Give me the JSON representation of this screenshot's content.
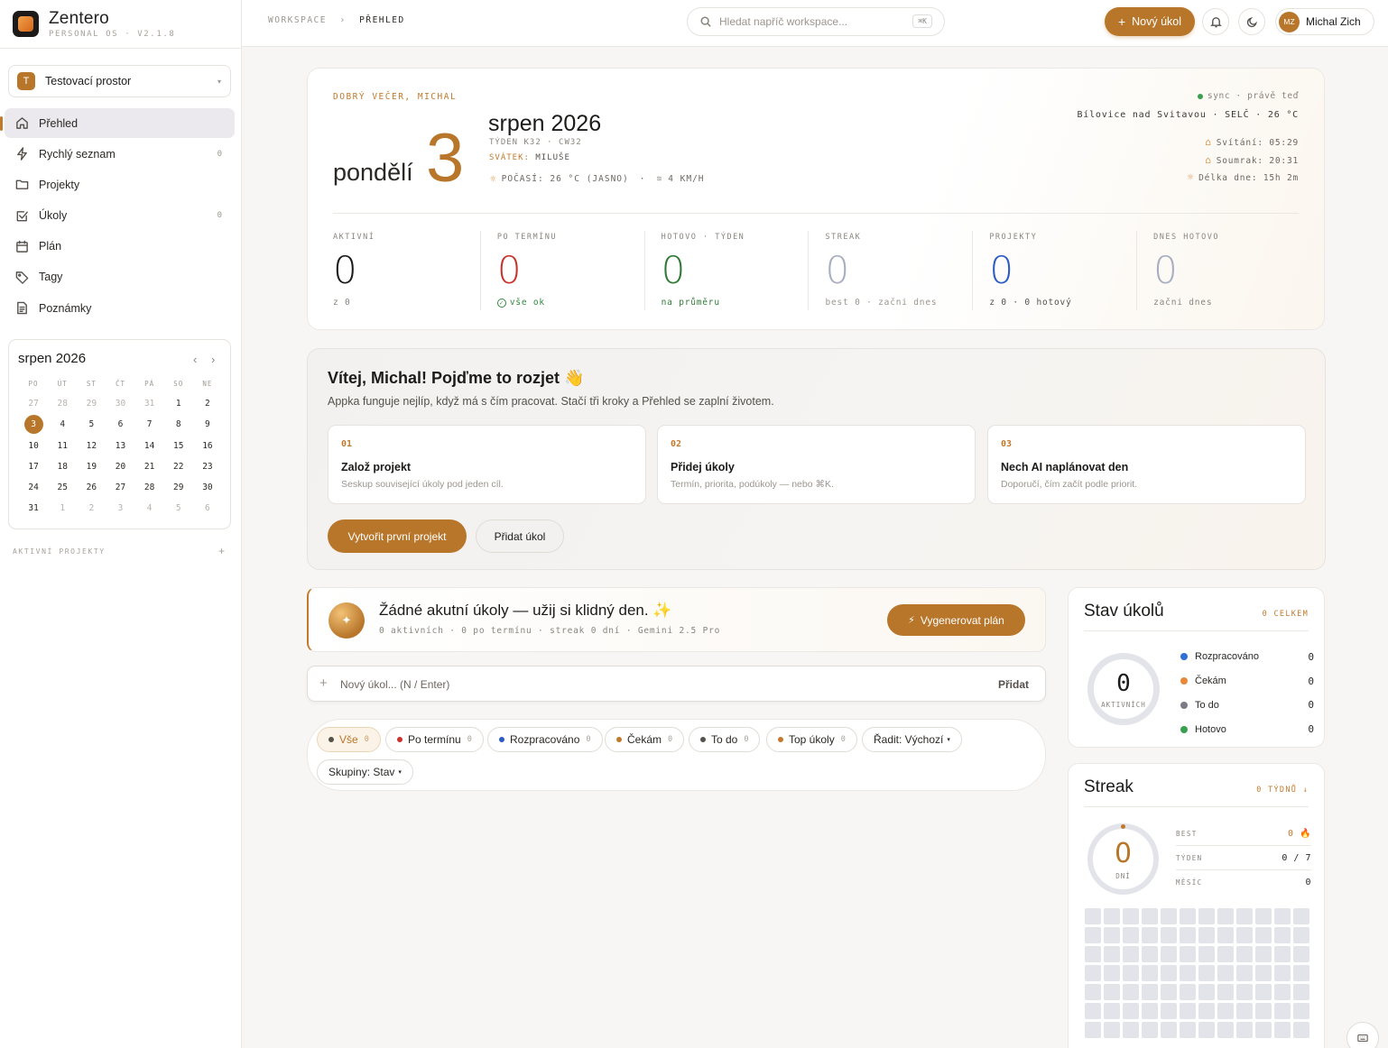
{
  "app": {
    "name": "Zentero",
    "version": "PERSONAL OS · V2.1.8"
  },
  "workspace": {
    "badge": "T",
    "name": "Testovací prostor"
  },
  "nav": [
    {
      "label": "Přehled",
      "count": "",
      "icon": "home-icon"
    },
    {
      "label": "Rychlý seznam",
      "count": "0",
      "icon": "bolt-icon"
    },
    {
      "label": "Projekty",
      "count": "",
      "icon": "folder-icon"
    },
    {
      "label": "Úkoly",
      "count": "0",
      "icon": "checkbox-icon"
    },
    {
      "label": "Plán",
      "count": "",
      "icon": "calendar-icon"
    },
    {
      "label": "Tagy",
      "count": "",
      "icon": "tag-icon"
    },
    {
      "label": "Poznámky",
      "count": "",
      "icon": "note-icon"
    }
  ],
  "calendar": {
    "title": "srpen 2026",
    "prev": "‹",
    "next": "›",
    "weekdays": [
      "PO",
      "ÚT",
      "ST",
      "ČT",
      "PÁ",
      "SO",
      "NE"
    ],
    "days": [
      {
        "d": "27",
        "out": true
      },
      {
        "d": "28",
        "out": true
      },
      {
        "d": "29",
        "out": true
      },
      {
        "d": "30",
        "out": true
      },
      {
        "d": "31",
        "out": true
      },
      {
        "d": "1"
      },
      {
        "d": "2"
      },
      {
        "d": "3",
        "today": true
      },
      {
        "d": "4"
      },
      {
        "d": "5"
      },
      {
        "d": "6"
      },
      {
        "d": "7"
      },
      {
        "d": "8"
      },
      {
        "d": "9"
      },
      {
        "d": "10"
      },
      {
        "d": "11"
      },
      {
        "d": "12"
      },
      {
        "d": "13"
      },
      {
        "d": "14"
      },
      {
        "d": "15"
      },
      {
        "d": "16"
      },
      {
        "d": "17"
      },
      {
        "d": "18"
      },
      {
        "d": "19"
      },
      {
        "d": "20"
      },
      {
        "d": "21"
      },
      {
        "d": "22"
      },
      {
        "d": "23"
      },
      {
        "d": "24"
      },
      {
        "d": "25"
      },
      {
        "d": "26"
      },
      {
        "d": "27"
      },
      {
        "d": "28"
      },
      {
        "d": "29"
      },
      {
        "d": "30"
      },
      {
        "d": "31"
      },
      {
        "d": "1",
        "out": true
      },
      {
        "d": "2",
        "out": true
      },
      {
        "d": "3",
        "out": true
      },
      {
        "d": "4",
        "out": true
      },
      {
        "d": "5",
        "out": true
      },
      {
        "d": "6",
        "out": true
      }
    ]
  },
  "sidebar": {
    "projects_label": "AKTIVNÍ PROJEKTY",
    "projects_add": "+"
  },
  "topbar": {
    "crumb_root": "WORKSPACE",
    "crumb_sep": "›",
    "crumb_current": "PŘEHLED",
    "search_placeholder": "Hledat napříč workspace...",
    "search_kbd": "⌘K",
    "new_task": "Nový úkol",
    "user_initials": "MZ",
    "user_name": "Michal Zich"
  },
  "hero": {
    "greeting": "DOBRÝ VEČER, MICHAL",
    "weekday": "pondělí",
    "day": "3",
    "month": "srpen 2026",
    "week": "TÝDEN K32 · CW32",
    "holiday_label": "SVÁTEK:",
    "holiday_name": "MILUŠE",
    "weather": "POČASÍ: 26 °C (JASNO)",
    "weather_sep": "·",
    "wind": "4 KM/H",
    "sync": "sync · právě teď",
    "location": "Bílovice nad Svitavou · SELČ · 26 °C",
    "sunrise": "Svítání: 05:29",
    "sunset": "Soumrak: 20:31",
    "daylength": "Délka dne: 15h 2m"
  },
  "stats": [
    {
      "label": "AKTIVNÍ",
      "value": "0",
      "sub": "z 0",
      "color": "#1c1b1a",
      "subcolor": "#8a857e"
    },
    {
      "label": "PO TERMÍNU",
      "value": "0",
      "sub": "vše ok",
      "color": "#c8332f",
      "subcolor": "#2f8a3e",
      "check": true
    },
    {
      "label": "HOTOVO · TÝDEN",
      "value": "0",
      "sub": "na průměru",
      "color": "#2f7a36",
      "subcolor": "#2f7a36"
    },
    {
      "label": "STREAK",
      "value": "0",
      "sub": "best 0 · začni dnes",
      "color": "#a8aec0",
      "subcolor": "#9b968f"
    },
    {
      "label": "PROJEKTY",
      "value": "0",
      "sub": "z 0 · 0 hotový",
      "color": "#2a5cc4",
      "subcolor": "#55514c"
    },
    {
      "label": "DNES HOTOVO",
      "value": "0",
      "sub": "začni dnes",
      "color": "#a8aec0",
      "subcolor": "#8a857e"
    }
  ],
  "welcome": {
    "title": "Vítej, Michal! Pojďme to rozjet 👋",
    "subtitle": "Appka funguje nejlíp, když má s čím pracovat. Stačí tři kroky a Přehled se zaplní životem.",
    "steps": [
      {
        "num": "01",
        "title": "Založ projekt",
        "desc": "Seskup související úkoly pod jeden cíl."
      },
      {
        "num": "02",
        "title": "Přidej úkoly",
        "desc": "Termín, priorita, podúkoly — nebo ⌘K."
      },
      {
        "num": "03",
        "title": "Nech AI naplánovat den",
        "desc": "Doporučí, čím začít podle priorit."
      }
    ],
    "primary": "Vytvořit první projekt",
    "secondary": "Přidat úkol"
  },
  "acute": {
    "title": "Žádné akutní úkoly — užij si klidný den. ✨",
    "sub": "0 aktivních · 0 po termínu · streak 0 dní · Gemini 2.5 Pro",
    "button": "Vygenerovat plán"
  },
  "newtask": {
    "placeholder": "Nový úkol... (N / Enter)",
    "add": "Přidat"
  },
  "filters": [
    {
      "label": "Vše",
      "count": "0",
      "dot": "#55514c",
      "active": true
    },
    {
      "label": "Po termínu",
      "count": "0",
      "dot": "#c8332f"
    },
    {
      "label": "Rozpracováno",
      "count": "0",
      "dot": "#2a5cc4"
    },
    {
      "label": "Čekám",
      "count": "0",
      "dot": "#c17a2c"
    },
    {
      "label": "To do",
      "count": "0",
      "dot": "#55514c"
    },
    {
      "label": "Top úkoly",
      "count": "0",
      "dot": "#c17a2c"
    },
    {
      "label": "Řadit: Výchozí",
      "caret": "▾"
    },
    {
      "label": "Skupiny: Stav",
      "caret": "▾"
    }
  ],
  "status": {
    "title": "Stav úkolů",
    "tag": "0 CELKEM",
    "ring_value": "0",
    "ring_label": "AKTIVNÍCH",
    "legend": [
      {
        "label": "Rozpracováno",
        "value": "0",
        "color": "#2f6fd6"
      },
      {
        "label": "Čekám",
        "value": "0",
        "color": "#e8893a"
      },
      {
        "label": "To do",
        "value": "0",
        "color": "#7d7b85"
      },
      {
        "label": "Hotovo",
        "value": "0",
        "color": "#3aa04f"
      }
    ]
  },
  "streak": {
    "title": "Streak",
    "tag": "0 TÝDNŮ ↓",
    "ring_value": "0",
    "ring_label": "DNÍ",
    "rows": [
      {
        "label": "BEST",
        "value": "0 🔥",
        "accent": true
      },
      {
        "label": "TÝDEN",
        "value": "0 / 7"
      },
      {
        "label": "MĚSÍC",
        "value": "0"
      }
    ]
  }
}
